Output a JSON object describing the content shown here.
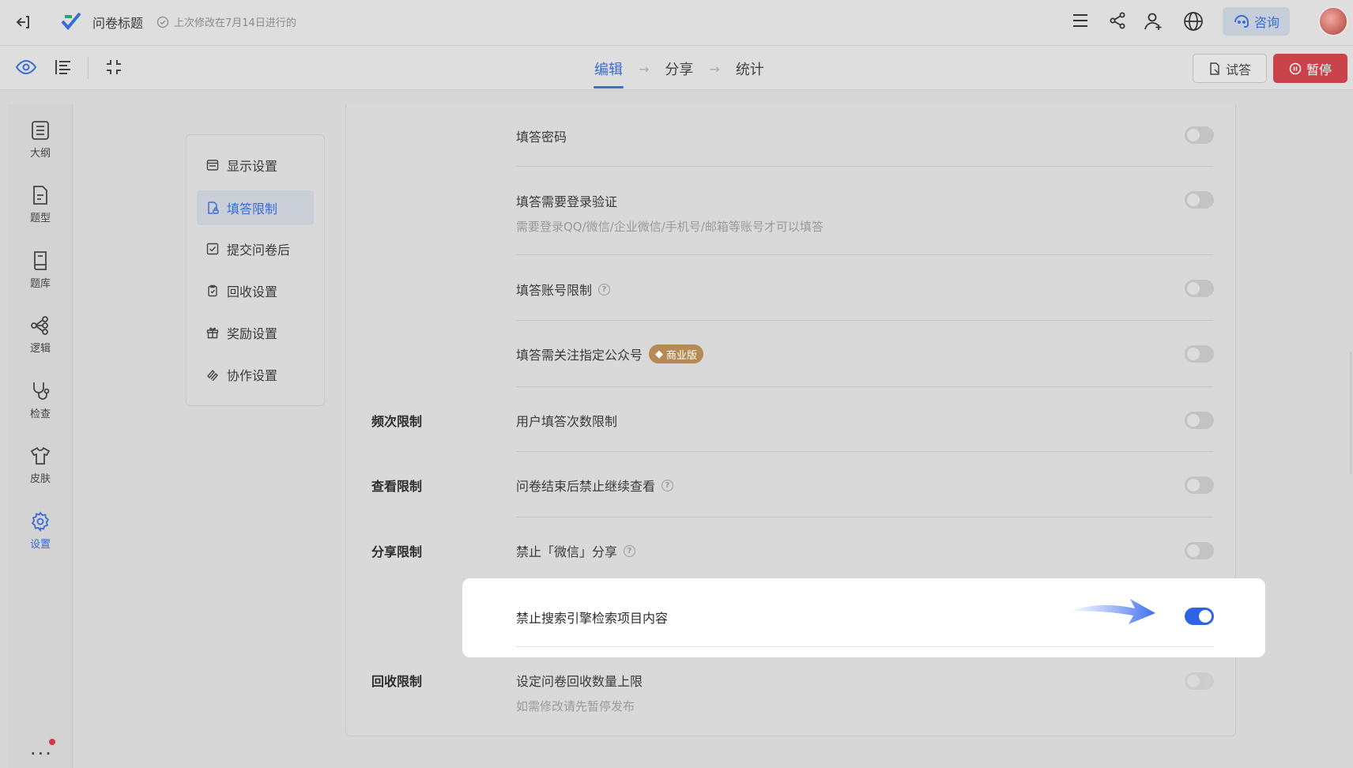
{
  "topbar": {
    "title": "问卷标题",
    "modified": "上次修改在7月14日进行的",
    "consult_label": "咨询",
    "icons": [
      "exit-icon",
      "logo-icon",
      "check-circle-icon",
      "menu-icon",
      "share-icon",
      "add-user-icon",
      "globe-icon",
      "headset-icon"
    ]
  },
  "subbar": {
    "steps": [
      "编辑",
      "分享",
      "统计"
    ],
    "try_label": "试答",
    "pause_label": "暂停",
    "icons": [
      "eye-icon",
      "list-icon",
      "collapse-icon"
    ]
  },
  "leftnav": {
    "items": [
      {
        "label": "大纲",
        "icon": "outline-icon"
      },
      {
        "label": "题型",
        "icon": "question-type-icon"
      },
      {
        "label": "题库",
        "icon": "question-bank-icon"
      },
      {
        "label": "逻辑",
        "icon": "logic-icon"
      },
      {
        "label": "检查",
        "icon": "stethoscope-icon"
      },
      {
        "label": "皮肤",
        "icon": "shirt-icon"
      },
      {
        "label": "设置",
        "icon": "gear-icon"
      }
    ],
    "more": "..."
  },
  "settings_nav": {
    "items": [
      "显示设置",
      "填答限制",
      "提交问卷后",
      "回收设置",
      "奖励设置",
      "协作设置"
    ]
  },
  "sections": {
    "frequency": "频次限制",
    "view": "查看限制",
    "share": "分享限制",
    "collect": "回收限制"
  },
  "rows": {
    "password": {
      "title": "填答密码",
      "on": false
    },
    "login": {
      "title": "填答需要登录验证",
      "sub": "需要登录QQ/微信/企业微信/手机号/邮箱等账号才可以填答",
      "on": false
    },
    "account": {
      "title": "填答账号限制",
      "help": "?",
      "on": false
    },
    "follow": {
      "title": "填答需关注指定公众号",
      "badge": "商业版",
      "on": false
    },
    "user_limit": {
      "title": "用户填答次数限制",
      "on": false
    },
    "after_end": {
      "title": "问卷结束后禁止继续查看",
      "help": "?",
      "on": false
    },
    "wechat_share": {
      "title": "禁止「微信」分享",
      "help": "?",
      "on": false
    },
    "search_engine": {
      "title": "禁止搜索引擎检索项目内容",
      "on": true
    },
    "quota": {
      "title": "设定问卷回收数量上限",
      "sub": "如需修改请先暂停发布",
      "on": false
    }
  },
  "colors": {
    "accent": "#3a6bd6",
    "toggle_on": "#2d64e6",
    "pause": "#c8434a",
    "badge": "#b58a54"
  }
}
